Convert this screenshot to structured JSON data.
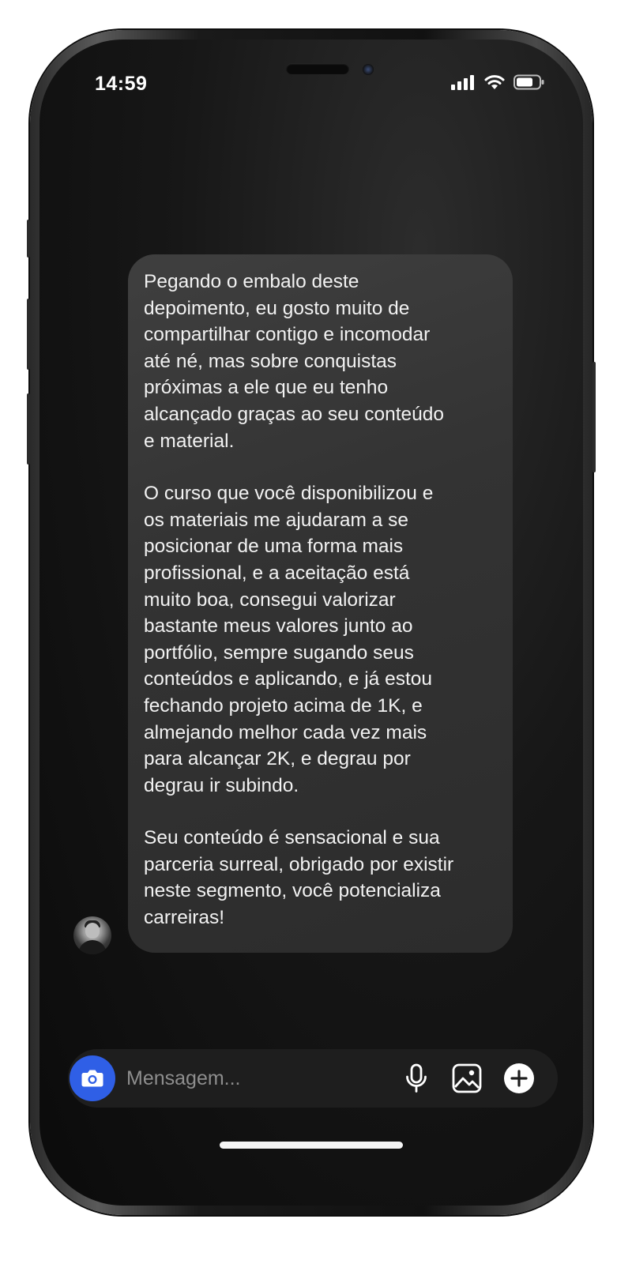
{
  "status_bar": {
    "time": "14:59",
    "signal_icon": "cellular-signal-icon",
    "wifi_icon": "wifi-icon",
    "battery_icon": "battery-icon"
  },
  "message": {
    "paragraphs": [
      "Pegando o embalo deste depoimento, eu gosto muito de compartilhar contigo e incomodar até né, mas sobre conquistas próximas a ele que eu tenho alcançado graças ao seu conteúdo e material.",
      "O curso que você disponibilizou e os materiais me ajudaram a se posicionar de uma forma mais profissional, e a aceitação está muito boa, consegui valorizar bastante meus valores junto ao portfólio, sempre sugando seus conteúdos e aplicando, e já estou fechando projeto acima de 1K, e almejando melhor cada vez mais para alcançar 2K, e degrau por degrau ir subindo.",
      "Seu conteúdo é sensacional e sua parceria surreal, obrigado por existir neste segmento, você potencializa carreiras!"
    ],
    "lines": [
      [
        "Pegando o embalo deste",
        "depoimento, eu gosto muito de",
        "compartilhar contigo e incomodar",
        "até né, mas sobre conquistas",
        "próximas a ele que eu tenho",
        "alcançado graças ao seu conteúdo",
        "e material."
      ],
      [
        "O curso que você disponibilizou e",
        "os materiais me ajudaram a se",
        "posicionar de uma forma mais",
        "profissional, e a aceitação está",
        "muito boa, consegui valorizar",
        "bastante meus valores junto ao",
        "portfólio, sempre sugando seus",
        "conteúdos e aplicando, e já estou",
        "fechando projeto acima de 1K, e",
        "almejando melhor cada vez mais",
        "para alcançar 2K, e degrau por",
        "degrau ir subindo."
      ],
      [
        "Seu conteúdo é sensacional e sua",
        "parceria surreal, obrigado por existir",
        "neste segmento, você potencializa",
        "carreiras!"
      ]
    ]
  },
  "composer": {
    "placeholder": "Mensagem...",
    "camera_icon": "camera-icon",
    "mic_icon": "microphone-icon",
    "gallery_icon": "image-icon",
    "add_icon": "plus-circle-icon"
  },
  "colors": {
    "screen_bg": "#0b0b0b",
    "bubble_bg": "#363636",
    "text": "#f2f2f2",
    "accent": "#2f5fe6",
    "placeholder": "#8e8e8e"
  }
}
